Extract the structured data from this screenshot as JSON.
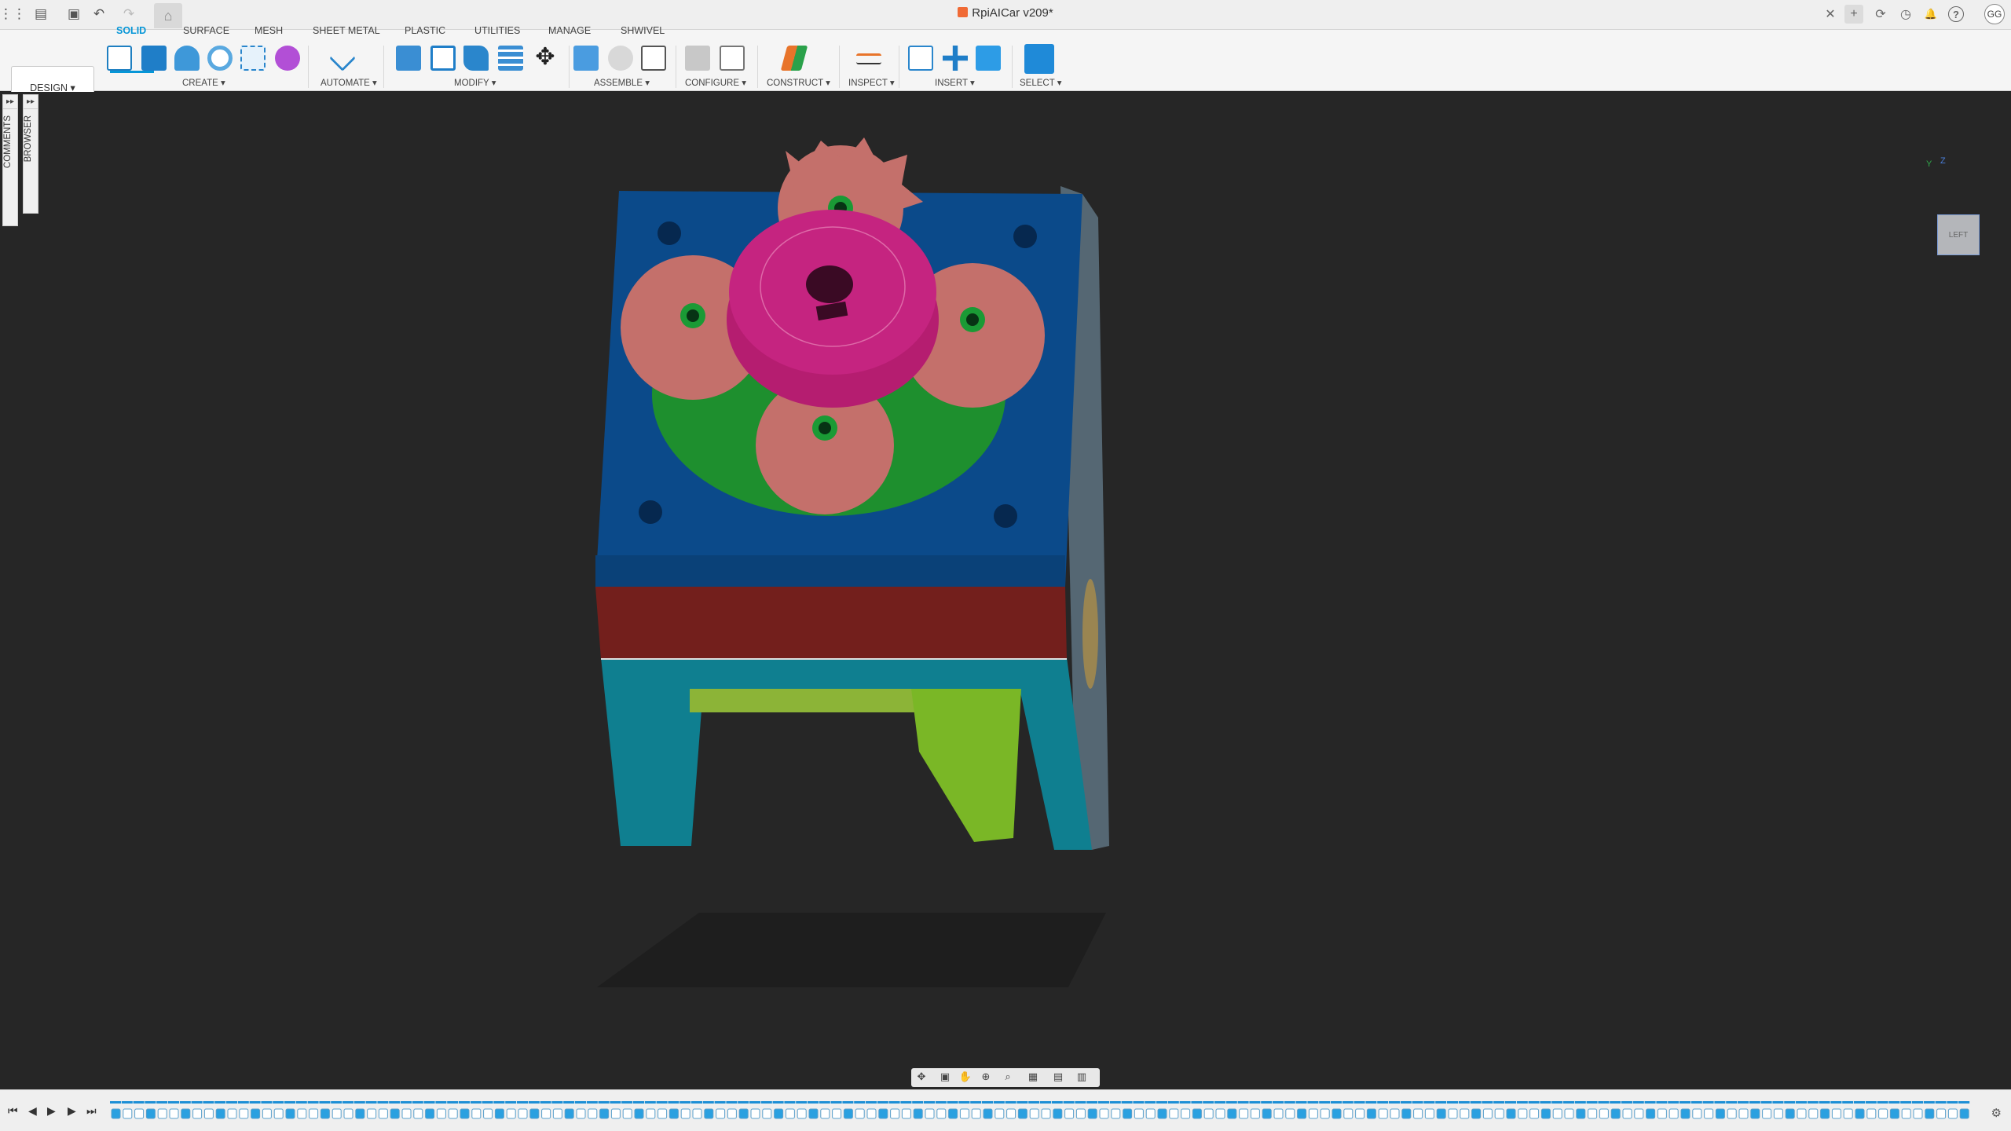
{
  "app": {
    "doc_title": "RpiAICar v209*",
    "user_initials": "GG"
  },
  "workspace": {
    "mode_label": "DESIGN ▾"
  },
  "tabs": [
    {
      "label": "SOLID",
      "active": true
    },
    {
      "label": "SURFACE",
      "active": false
    },
    {
      "label": "MESH",
      "active": false
    },
    {
      "label": "SHEET METAL",
      "active": false
    },
    {
      "label": "PLASTIC",
      "active": false
    },
    {
      "label": "UTILITIES",
      "active": false
    },
    {
      "label": "MANAGE",
      "active": false
    },
    {
      "label": "SHWIVEL",
      "active": false
    }
  ],
  "groups": {
    "create": "CREATE ▾",
    "automate": "AUTOMATE ▾",
    "modify": "MODIFY ▾",
    "assemble": "ASSEMBLE ▾",
    "configure": "CONFIGURE ▾",
    "construct": "CONSTRUCT ▾",
    "inspect": "INSPECT ▾",
    "insert": "INSERT ▾",
    "select": "SELECT ▾"
  },
  "side_panels": {
    "comments": "COMMENTS",
    "browser": "BROWSER"
  },
  "viewcube": {
    "face_label": "LEFT",
    "axis_z": "Z",
    "axis_y": "Y"
  },
  "icons": {
    "grid": "⋮⋮",
    "file": "▤",
    "save": "▣",
    "undo": "↶",
    "redo": "↷",
    "home": "⌂",
    "close": "✕",
    "add": "+",
    "extensions": "⟳",
    "jobs": "◷",
    "notifications": "🔔",
    "help": "?",
    "panel_expand": "▸▸",
    "timeline_first": "⏮",
    "timeline_prev": "◀",
    "timeline_play": "▶",
    "timeline_next": "▶",
    "timeline_last": "⏭",
    "settings": "⚙"
  },
  "colors": {
    "accent": "#0696d7",
    "model_blue": "#0c4a8a",
    "model_red": "#7a1f1c",
    "model_teal": "#0f7f90",
    "gear_salmon": "#c7716c",
    "gear_magenta": "#c21f7a",
    "gear_green": "#1e8f2e",
    "worm_lime": "#7ab726"
  }
}
